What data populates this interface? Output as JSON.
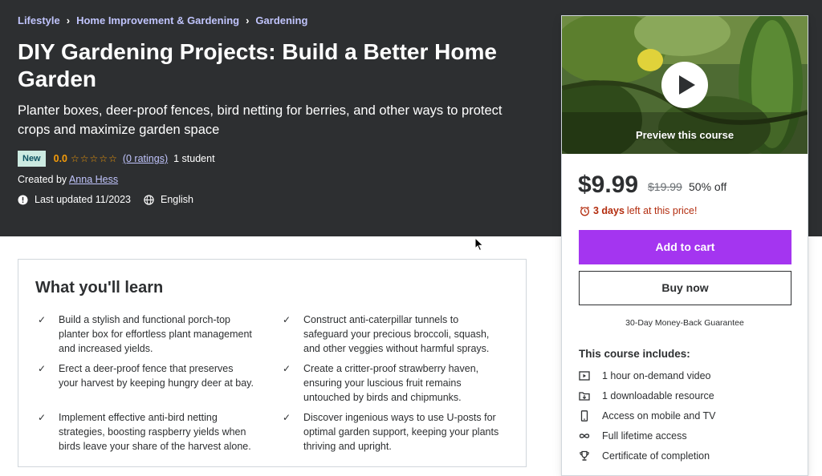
{
  "breadcrumb": [
    "Lifestyle",
    "Home Improvement & Gardening",
    "Gardening"
  ],
  "course": {
    "title": "DIY Gardening Projects: Build a Better Home Garden",
    "subtitle": "Planter boxes, deer-proof fences, bird netting for berries, and other ways to protect crops and maximize garden space",
    "badge": "New",
    "rating": "0.0",
    "ratings_link": "(0 ratings)",
    "students": "1 student",
    "created_by_label": "Created by",
    "instructor": "Anna Hess",
    "last_updated": "Last updated 11/2023",
    "language": "English"
  },
  "learn": {
    "title": "What you'll learn",
    "items": [
      "Build a stylish and functional porch-top planter box for effortless plant management and increased yields.",
      "Construct anti-caterpillar tunnels to safeguard your precious broccoli, squash, and other veggies without harmful sprays.",
      "Erect a deer-proof fence that preserves your harvest by keeping hungry deer at bay.",
      "Create a critter-proof strawberry haven, ensuring your luscious fruit remains untouched by birds and chipmunks.",
      "Implement effective anti-bird netting strategies, boosting raspberry yields when birds leave your share of the harvest alone.",
      "Discover ingenious ways to use U-posts for optimal garden support, keeping your plants thriving and upright."
    ]
  },
  "sidebar": {
    "preview_label": "Preview this course",
    "price": "$9.99",
    "original_price": "$19.99",
    "discount": "50% off",
    "timer_days": "3 days",
    "timer_rest": "left at this price!",
    "add_to_cart": "Add to cart",
    "buy_now": "Buy now",
    "guarantee": "30-Day Money-Back Guarantee",
    "includes_title": "This course includes:",
    "includes": [
      "1 hour on-demand video",
      "1 downloadable resource",
      "Access on mobile and TV",
      "Full lifetime access",
      "Certificate of completion"
    ]
  },
  "colors": {
    "hero_bg": "#2d2f31",
    "accent_purple": "#a435f0",
    "link_lavender": "#c0c4fc",
    "star_orange": "#f69c08",
    "timer_red": "#b32d0f",
    "badge_bg": "#cceae1"
  },
  "icons": [
    "chevron-right-icon",
    "alert-icon",
    "globe-icon",
    "star-empty-icon",
    "check-icon",
    "play-icon",
    "alarm-clock-icon",
    "video-icon",
    "download-icon",
    "mobile-icon",
    "infinity-icon",
    "trophy-icon",
    "mouse-cursor-icon"
  ]
}
